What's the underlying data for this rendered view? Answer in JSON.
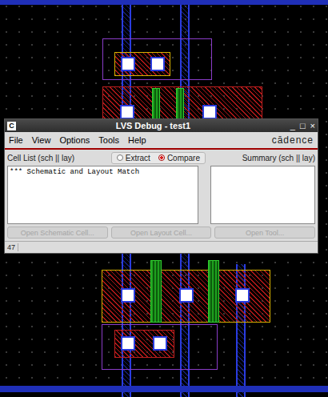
{
  "window": {
    "title": "LVS Debug - test1",
    "icon": "C",
    "controls": [
      "_",
      "□",
      "×"
    ]
  },
  "menu": [
    "File",
    "View",
    "Options",
    "Tools",
    "Help"
  ],
  "logo": "cādence",
  "mode": [
    {
      "label": "Extract",
      "selected": false
    },
    {
      "label": "Compare",
      "selected": true
    }
  ],
  "cell_list": {
    "label": "Cell List (sch || lay)",
    "items": [
      "*** Schematic and Layout Match"
    ]
  },
  "summary": {
    "label": "Summary (sch || lay)",
    "items": []
  },
  "buttons": [
    {
      "label": "Open Schematic Cell...",
      "disabled": true
    },
    {
      "label": "Open Layout Cell...",
      "disabled": true
    },
    {
      "label": "Open Tool...",
      "disabled": true
    }
  ],
  "status": "47"
}
